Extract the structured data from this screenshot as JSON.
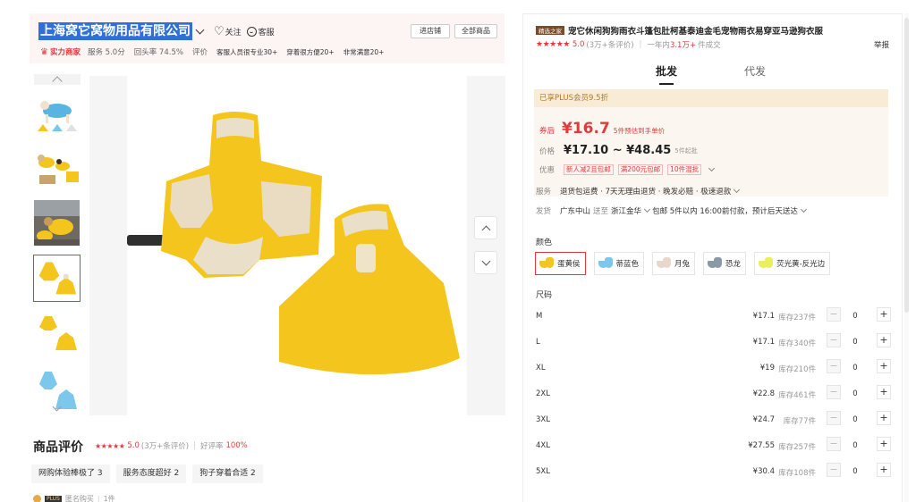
{
  "store": {
    "name": "上海窝它窝物用品有限公司",
    "follow_label": "关注",
    "service_label": "客服",
    "enter_shop_label": "进店铺",
    "all_products_label": "全部商品",
    "strength_badge": "实力商家",
    "service_score": "服务 5.0分",
    "repurchase_rate": "回头率 74.5%",
    "eval_label": "评价",
    "tags": [
      "客服人员很专业30+",
      "穿着很方便20+",
      "非常满意20+"
    ]
  },
  "gallery": {
    "thumbnails": [
      "thumb-1",
      "thumb-2",
      "thumb-3",
      "thumb-4",
      "thumb-5",
      "thumb-6"
    ],
    "active_index": 3
  },
  "reviews": {
    "title": "商品评价",
    "rating": "5.0",
    "count_text": "(3万+条评价)",
    "good_rate_label": "好评率",
    "good_rate": "100%",
    "tags": [
      "网购体验棒极了 3",
      "服务态度超好 2",
      "狗子穿着合适 2"
    ],
    "reviewer_name": "匿名购买",
    "reviewer_count": "1件",
    "plus_badge": "PLUS"
  },
  "product": {
    "shop_badge": "精选之家",
    "title": "宠它休闲狗狗雨衣斗篷包肚柯基泰迪金毛宠物雨衣易穿亚马逊狗衣服",
    "rating": "5.0",
    "review_count": "(3万+条评价)",
    "sales_text_prefix": "一年内",
    "sales_count": "3.1万+",
    "sales_text_suffix": "件成交",
    "report_label": "举报",
    "tabs": [
      "批发",
      "代发"
    ],
    "active_tab": 0
  },
  "pricing": {
    "plus_strip": "已享PLUS会员9.5折",
    "coupon_label": "券后",
    "coupon_price": "¥16.7",
    "coupon_note": "5件预估到手单价",
    "price_label": "价格",
    "price_range": "¥17.10 ~ ¥48.45",
    "min_order": "5件起批",
    "promo_label": "优惠",
    "promos": [
      "新人减2且包邮",
      "满200元包邮",
      "10件混批"
    ],
    "service_label": "服务",
    "service_text": "退货包运费 · 7天无理由退货 · 晚发必赔 · 极速退款",
    "ship_label": "发货",
    "ship_from": "广东中山",
    "ship_to_word": "送至",
    "ship_to": "浙江金华",
    "ship_text": "包邮  5件以内  16:00前付款，预计后天送达"
  },
  "colors": {
    "label": "颜色",
    "options": [
      "蛋黄侯",
      "蒂蓝色",
      "月兔",
      "恐龙",
      "荧光黄-反光边"
    ],
    "swatches": [
      "yellow",
      "blue",
      "beige",
      "gray",
      "fluor"
    ],
    "selected": 0
  },
  "sizes": {
    "label": "尺码",
    "rows": [
      {
        "name": "M",
        "price": "¥17.1",
        "stock": "库存237件",
        "qty": "0"
      },
      {
        "name": "L",
        "price": "¥17.1",
        "stock": "库存340件",
        "qty": "0"
      },
      {
        "name": "XL",
        "price": "¥19",
        "stock": "库存210件",
        "qty": "0"
      },
      {
        "name": "2XL",
        "price": "¥22.8",
        "stock": "库存461件",
        "qty": "0"
      },
      {
        "name": "3XL",
        "price": "¥24.7",
        "stock": "库存77件",
        "qty": "0"
      },
      {
        "name": "4XL",
        "price": "¥27.55",
        "stock": "库存257件",
        "qty": "0"
      },
      {
        "name": "5XL",
        "price": "¥30.4",
        "stock": "库存108件",
        "qty": "0"
      }
    ]
  },
  "colors_theme": {
    "accent": "#e4393c",
    "product_yellow": "#f4c51d",
    "selection_blue": "#2f6fd8"
  }
}
